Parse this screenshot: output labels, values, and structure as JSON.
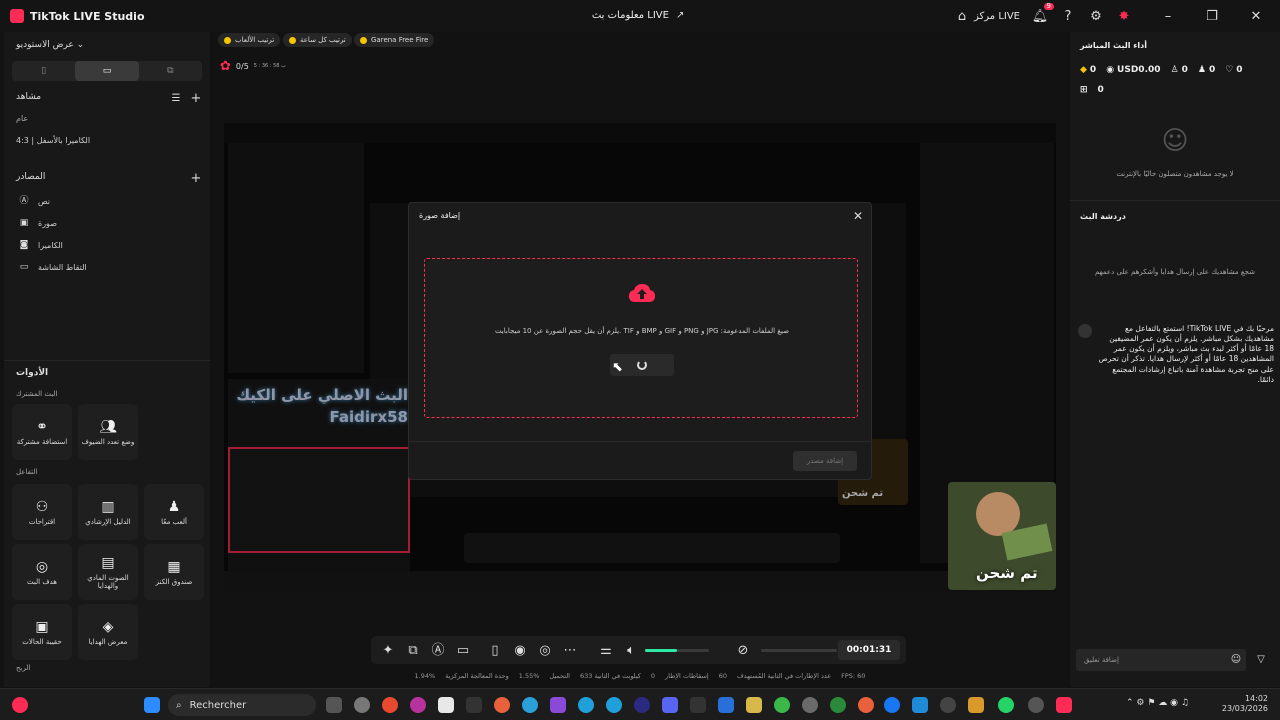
{
  "app": {
    "title": "TikTok LIVE Studio",
    "center_title": "معلومات بث LIVE",
    "live_center": "مركز LIVE",
    "notif_count": "9"
  },
  "left": {
    "studio_view": "عرض الاستوديو",
    "scenes_title": "مشاهد",
    "scene_group": "عام",
    "scene_item": "الكاميرا بالأسفل | 4:3",
    "sources_title": "المصادر",
    "sources": [
      "نص",
      "صورة",
      "الكاميرا",
      "التقاط الشاشة"
    ],
    "tools_title": "الأدوات",
    "shared_live_title": "البث المشترك",
    "shared_live_tools": [
      "استضافة مشتركة",
      "وضع تعدد الضيوف"
    ],
    "interaction_title": "التفاعل",
    "interaction_tools": [
      "اقتراحات",
      "الدليل الإرشادي",
      "ألعب معًا",
      "هدف البث",
      "الصوت المادي والهدايا",
      "صندوق الكنز",
      "حقيبة الحالات",
      "معرض الهدايا"
    ],
    "bottom_label": "الربح"
  },
  "topbar": {
    "chips": [
      "ترتيب الألعاب",
      "ترتيب كل ساعة",
      "Garena Free Fire"
    ],
    "rose_count": "0/5",
    "rose_timer": "ب 58 : 36 : 5"
  },
  "dialog": {
    "title": "إضافة صورة",
    "hint": "يلزم أن يقل حجم الصورة عن 10 ميجابايت. TIF و BMP و GIF و PNG و JPG :صيغ الملفات المدعومة",
    "add_button": "إضافة مصدر"
  },
  "preview": {
    "overlay_text_line1": "البث الاصلي على الكيك",
    "overlay_text_line2": "Faidirx58",
    "promo_text": "تم شحن"
  },
  "right": {
    "performance_title": "أداء البث المباشر",
    "stats": {
      "coins": "0",
      "usd": "USD0.00",
      "viewers": "0",
      "followers": "0",
      "likes": "0",
      "gifts": "0"
    },
    "no_viewers": "لا يوجد مشاهدون متصلون حاليًا بالإنترنت",
    "gift_title": "دردشة البث",
    "gift_hint": "شجع مشاهديك على إرسال هدايا وأشكرهم على دعمهم",
    "comment": "مرحبًا بك في TikTok LIVE! استمتع بالتفاعل مع مشاهديك بشكل مباشر. يلزم أن يكون عمر المضيفين 18 عامًا أو أكثر لبدء بث مباشر، ويلزم أن يكون عمر المشاهدين 18 عامًا أو أكثر لإرسال هدايا. تذكر أن تحرص على منح تجربة مشاهدة آمنة باتباع إرشادات المجتمع دائمًا.",
    "comment_input_placeholder": "إضافة تعليق"
  },
  "livebar": {
    "timer": "00:01:31",
    "volume_level": 0.5
  },
  "status": {
    "fps": "FPS: 60",
    "frames": "60",
    "frames_label": "عدد الإطارات في الثانية المُستهدف",
    "drop": "0",
    "drop_label": "إسقاطات الإطار",
    "bitrate": "633 كيلوبت في الثانية",
    "cpu": "1.55%",
    "cpu_label": "التحميل",
    "gpu": "1.94%",
    "gpu_label": "وحدة المعالجة المركزية"
  },
  "taskbar": {
    "search": "Rechercher",
    "time": "14:02",
    "date": "23/03/2026"
  }
}
